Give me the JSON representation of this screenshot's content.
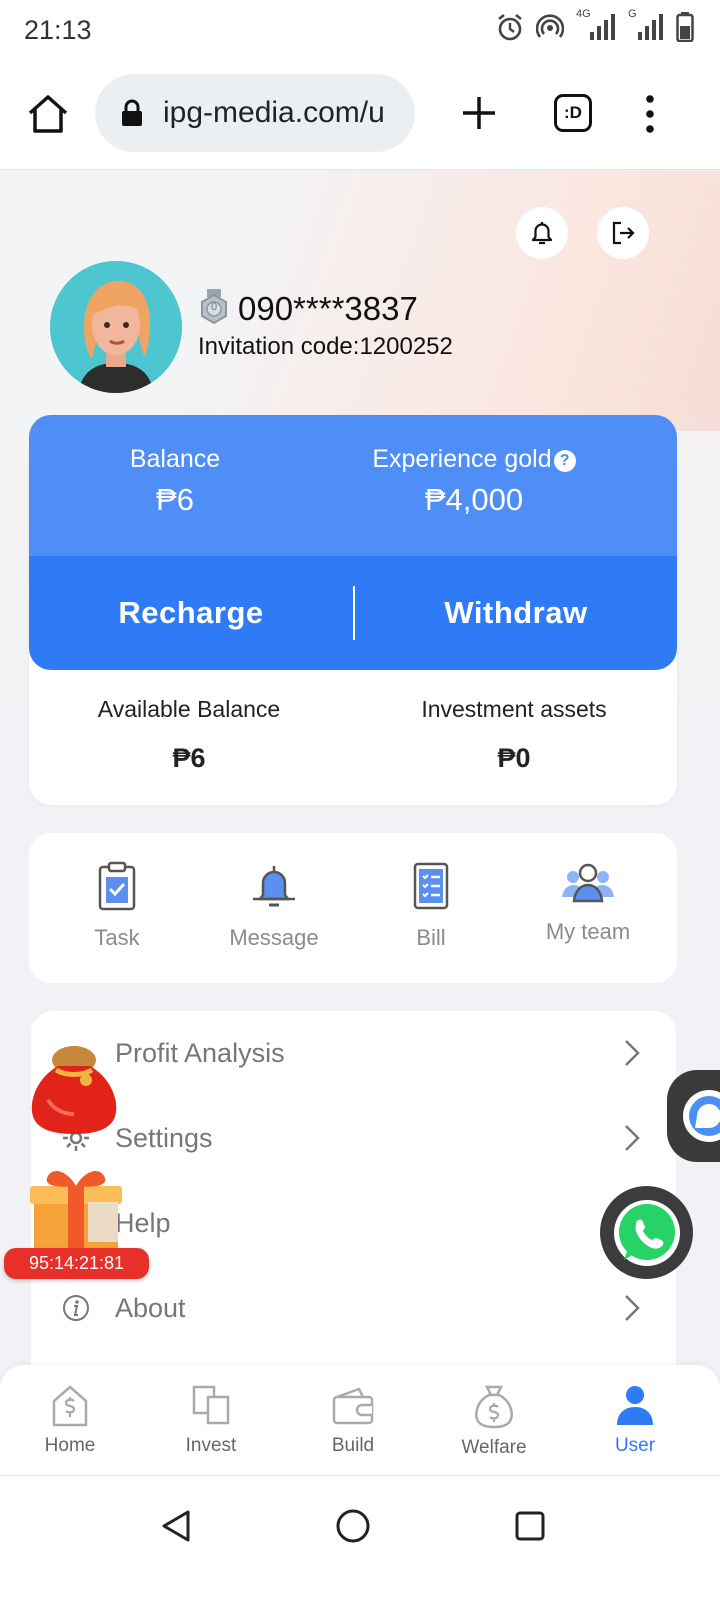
{
  "status_bar": {
    "time": "21:13",
    "network_label_1": "4G",
    "network_label_2": "G"
  },
  "browser": {
    "url": "ipg-media.com/u",
    "tabs_label": ":D"
  },
  "profile": {
    "level": "0",
    "phone": "090****3837",
    "invitation": "Invitation code:1200252"
  },
  "balance": {
    "balance_label": "Balance",
    "balance_value": "₱6",
    "experience_label": "Experience gold",
    "experience_help": "?",
    "experience_value": "₱4,000",
    "recharge_label": "Recharge",
    "withdraw_label": "Withdraw",
    "available_label": "Available Balance",
    "available_value": "₱6",
    "investment_label": "Investment assets",
    "investment_value": "₱0"
  },
  "quick_actions": [
    {
      "label": "Task",
      "icon": "clipboard-check-icon"
    },
    {
      "label": "Message",
      "icon": "bell-icon"
    },
    {
      "label": "Bill",
      "icon": "list-document-icon"
    },
    {
      "label": "My team",
      "icon": "team-icon"
    }
  ],
  "menu": [
    {
      "label": "Profit Analysis",
      "icon": "chart-icon"
    },
    {
      "label": "Settings",
      "icon": "gear-icon"
    },
    {
      "label": "Help",
      "icon": "help-icon"
    },
    {
      "label": "About",
      "icon": "info-icon"
    }
  ],
  "promo": {
    "timer": "95:14:21:81"
  },
  "bottom_nav": [
    {
      "label": "Home",
      "icon": "home-dollar-icon",
      "active": false
    },
    {
      "label": "Invest",
      "icon": "invest-icon",
      "active": false
    },
    {
      "label": "Build",
      "icon": "wallet-icon",
      "active": false
    },
    {
      "label": "Welfare",
      "icon": "money-bag-icon",
      "active": false
    },
    {
      "label": "User",
      "icon": "user-icon",
      "active": true
    }
  ],
  "colors": {
    "primary": "#2f7bf5",
    "card_blue": "#4f8ef7",
    "timer_red": "#e8302b",
    "whatsapp": "#25d366"
  }
}
